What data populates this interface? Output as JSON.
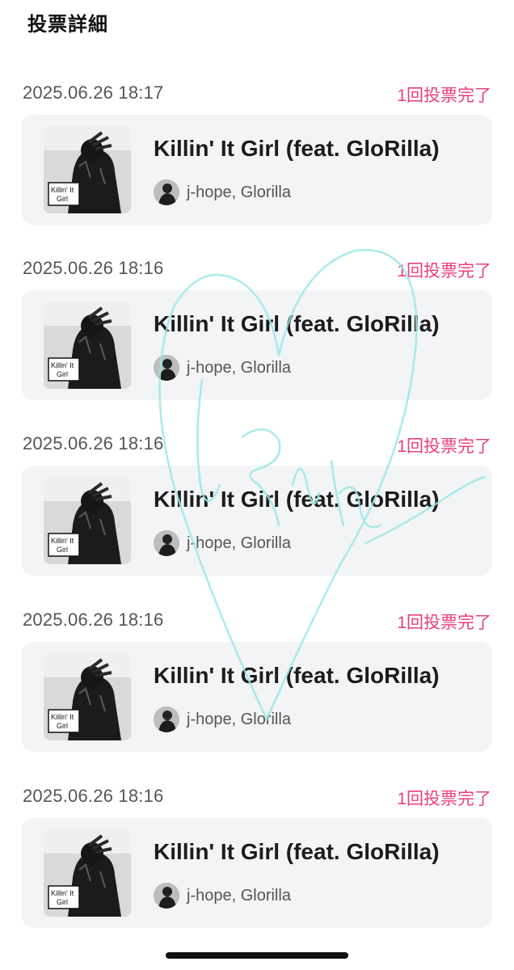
{
  "header": {
    "title": "投票詳細"
  },
  "votes": [
    {
      "time": "2025.06.26 18:17",
      "status": "1回投票完了",
      "song": {
        "title": "Killin' It Girl (feat. GloRilla)",
        "artists": "j-hope, Glorilla",
        "art_text_1": "Killin' It",
        "art_text_2": "Girl"
      }
    },
    {
      "time": "2025.06.26 18:16",
      "status": "1回投票完了",
      "song": {
        "title": "Killin' It Girl (feat. GloRilla)",
        "artists": "j-hope, Glorilla",
        "art_text_1": "Killin' It",
        "art_text_2": "Girl"
      }
    },
    {
      "time": "2025.06.26 18:16",
      "status": "1回投票完了",
      "song": {
        "title": "Killin' It Girl (feat. GloRilla)",
        "artists": "j-hope, Glorilla",
        "art_text_1": "Killin' It",
        "art_text_2": "Girl"
      }
    },
    {
      "time": "2025.06.26 18:16",
      "status": "1回投票完了",
      "song": {
        "title": "Killin' It Girl (feat. GloRilla)",
        "artists": "j-hope, Glorilla",
        "art_text_1": "Killin' It",
        "art_text_2": "Girl"
      }
    },
    {
      "time": "2025.06.26 18:16",
      "status": "1回投票完了",
      "song": {
        "title": "Killin' It Girl (feat. GloRilla)",
        "artists": "j-hope, Glorilla",
        "art_text_1": "Killin' It",
        "art_text_2": "Girl"
      }
    }
  ],
  "colors": {
    "status": "#e8407a",
    "card_background": "#f2f4f6",
    "watermark": "#9be8e8"
  }
}
